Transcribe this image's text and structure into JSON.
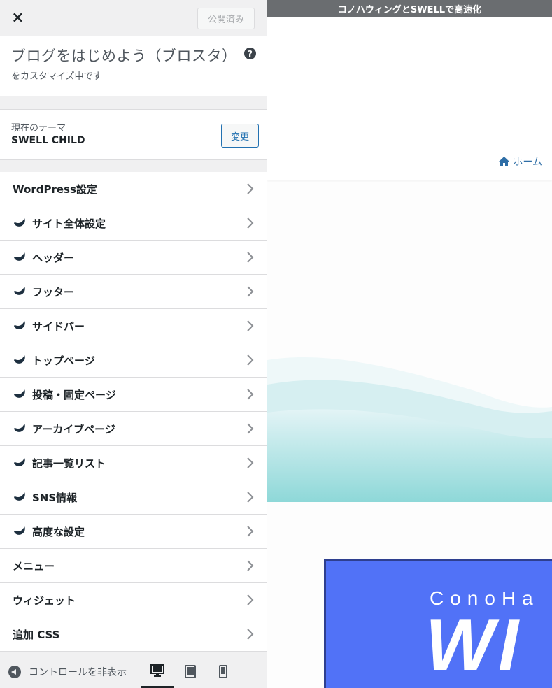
{
  "sidebar": {
    "close_label": "×",
    "publish_label": "公開済み",
    "site_title": "ブログをはじめよう（ブロスタ）",
    "help_label": "?",
    "customizing_label": "をカスタマイズ中です",
    "theme": {
      "label": "現在のテーマ",
      "name": "SWELL CHILD",
      "change_label": "変更"
    },
    "menu": [
      {
        "label": "WordPress設定",
        "swell": false
      },
      {
        "label": "サイト全体設定",
        "swell": true
      },
      {
        "label": "ヘッダー",
        "swell": true
      },
      {
        "label": "フッター",
        "swell": true
      },
      {
        "label": "サイドバー",
        "swell": true
      },
      {
        "label": "トップページ",
        "swell": true
      },
      {
        "label": "投稿・固定ページ",
        "swell": true
      },
      {
        "label": "アーカイブページ",
        "swell": true
      },
      {
        "label": "記事一覧リスト",
        "swell": true
      },
      {
        "label": "SNS情報",
        "swell": true
      },
      {
        "label": "高度な設定",
        "swell": true
      },
      {
        "label": "メニュー",
        "swell": false
      },
      {
        "label": "ウィジェット",
        "swell": false
      },
      {
        "label": "追加 CSS",
        "swell": false
      }
    ],
    "footer": {
      "collapse_label": "コントロールを非表示",
      "devices": [
        "desktop-icon",
        "tablet-icon",
        "mobile-icon"
      ],
      "active_device": "desktop"
    }
  },
  "preview": {
    "promo_text": "コノハウィングとSWELLで高速化",
    "home_label": "ホーム",
    "banner": {
      "subtitle": "ConoHa",
      "main": "WI"
    },
    "colors": {
      "accent": "#2e6ea6",
      "banner_bg": "#5172f7",
      "wave": "#8ed8d8"
    }
  }
}
